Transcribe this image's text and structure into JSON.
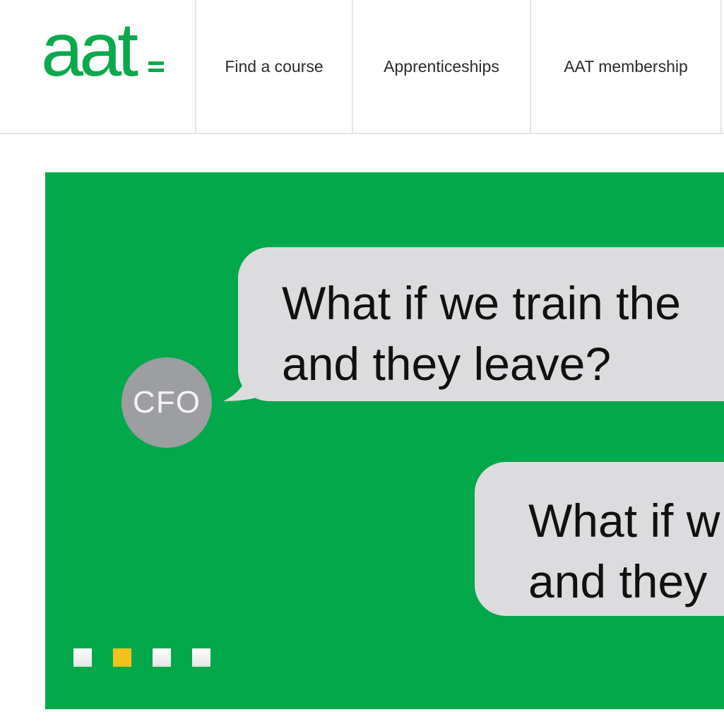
{
  "brand": {
    "logo_text": "aat",
    "color": "#0aa94c"
  },
  "nav": {
    "items": [
      {
        "label": "Find a course"
      },
      {
        "label": "Apprenticeships"
      },
      {
        "label": "AAT membership"
      }
    ]
  },
  "hero": {
    "background_color": "#03a84b",
    "avatar_label": "CFO",
    "bubble_1": {
      "line_1": "What if we train the",
      "line_2": "and they leave?"
    },
    "bubble_2": {
      "line_1": "What if w",
      "line_2": "and they"
    },
    "carousel": {
      "slide_count": 4,
      "active_index": 1,
      "active_color": "#f6c21a"
    }
  }
}
